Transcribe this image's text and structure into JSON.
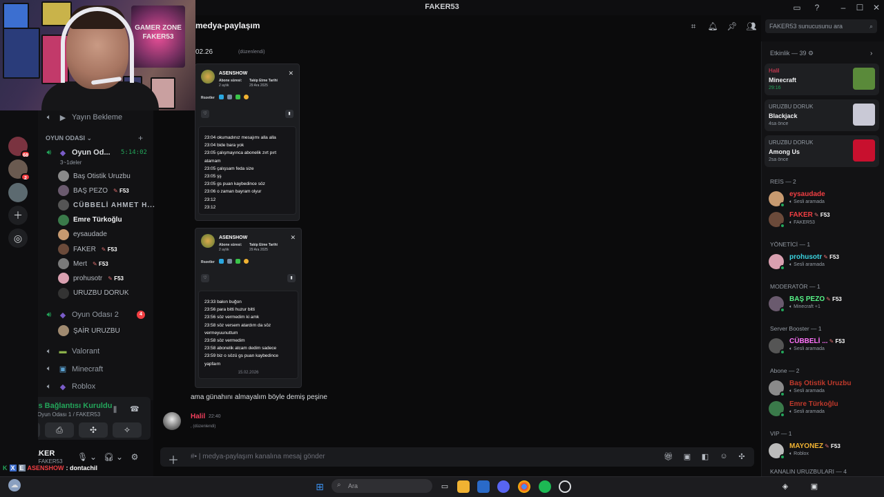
{
  "window": {
    "title": "FAKER53"
  },
  "webcam": {
    "sign_text": "GAMER ZONE FAKER53"
  },
  "rail": {
    "servers": [
      {
        "badge": "68",
        "color": "#7a3340"
      },
      {
        "badge": "2",
        "color": "#6a5a50"
      },
      {
        "badge": "",
        "color": "#5c6a70"
      }
    ]
  },
  "channels": {
    "waiting": "Yayın Bekleme",
    "category": "OYUN ODASI",
    "room1": {
      "name": "Oyun Od...",
      "timer": "5:14:02",
      "subtitle": "3~1deler"
    },
    "members": [
      {
        "name": "Baş Otistik Uruzbu",
        "tag": "",
        "color": "#8a8a8a"
      },
      {
        "name": "BAŞ PEZO",
        "tag": "F53",
        "color": "#6a5a6e"
      },
      {
        "name": "CÜBBELİ AHMET H...",
        "tag": "",
        "color": "#555"
      },
      {
        "name": "Emre Türkoğlu",
        "tag": "",
        "color": "#3a7a4a"
      },
      {
        "name": "eysaudade",
        "tag": "",
        "color": "#c79a70"
      },
      {
        "name": "FAKER",
        "tag": "F53",
        "color": "#6b4a3a"
      },
      {
        "name": "Mert",
        "tag": "F53",
        "color": "#7a7a7a"
      },
      {
        "name": "prohusotr",
        "tag": "F53",
        "color": "#d9a0b0"
      },
      {
        "name": "URUZBU DORUK",
        "tag": "",
        "color": "#333"
      }
    ],
    "room2": {
      "name": "Oyun Odası 2",
      "badge": "4"
    },
    "room2_member": "ŞAİR URUZBU",
    "others": [
      "Valorant",
      "Minecraft",
      "Roblox"
    ]
  },
  "voice": {
    "status": "Ses Bağlantısı Kuruldu",
    "sub": "Oyun Odası 1 / FAKER53"
  },
  "user": {
    "name": "FAKER",
    "status": "FAKER53"
  },
  "ticker": {
    "user": "ASENSHOW",
    "text": ": dontachil"
  },
  "header": {
    "channel": "medya-paylaşım",
    "search_placeholder": "FAKER53 sunucusunu ara"
  },
  "messages": {
    "date": "02.26",
    "edited": "(düzenlendi)",
    "card1": {
      "name": "ASENSHOW",
      "k1": "Abone süresi:",
      "v1": "2 aylık",
      "k2": "Takip Etme Tarihi",
      "v2": "29 Ara 2025",
      "rozet": "Rozetler",
      "log": [
        "23:04 okumadınız mesajımı alla alla",
        "23:04 bide bara yok",
        "23:05 çalışmayınca abonelik zırt pırt",
        "atamam",
        "23:05 çalışsam feda size",
        "23:05 şş",
        "23:05 gs puan kaybedince söz",
        "23:06 o zaman bayram olyur",
        "23:12",
        "23:12"
      ]
    },
    "card2": {
      "name": "ASENSHOW",
      "k1": "Abone süresi:",
      "v1": "2 aylık",
      "k2": "Takip Etme Tarihi",
      "v2": "29 Ara 2025",
      "rozet": "Rozetler",
      "log": [
        "23:33 bakın buğon",
        "23:56 para bitti huzur bitti",
        "23:56 söz vermedim ki amk",
        "23:58 söz versem atardım da söz",
        "vermeyuunuttum",
        "23:58 söz vermedim",
        "23:58 abonelik atcam dedim sadece",
        "23:59 biz o sözü gs puan kaybedince",
        "yapfaım"
      ],
      "log_date": "15.02.2026"
    },
    "text": "ama günahını almayalım böyle demiş peşine",
    "msg2": {
      "user": "Halil",
      "time": "22:40",
      "edited": ", (düzenlendi)"
    }
  },
  "input": {
    "placeholder": "medya-paylaşım kanalına mesaj gönder"
  },
  "members": {
    "activity_header": "Etkinlik — 39",
    "activities": [
      {
        "user": "Halil",
        "game": "Minecraft",
        "time": "29:16",
        "art": "#5a8a3a",
        "user_color": "#f23f5d",
        "time_color": "#23a55a"
      },
      {
        "user": "URUZBU DORUK",
        "game": "Blackjack",
        "time": "4sa önce",
        "art": "#c9c9d6",
        "user_color": "#949ba4",
        "time_color": "#949ba4"
      },
      {
        "user": "URUZBU DORUK",
        "game": "Among Us",
        "time": "2sa önce",
        "art": "#c8102e",
        "user_color": "#949ba4",
        "time_color": "#949ba4"
      }
    ],
    "groups": [
      {
        "title": "REİS — 2",
        "items": [
          {
            "name": "eysaudade",
            "sub": "Sesli aramada",
            "color": "#f23f43",
            "av": "#c79a70",
            "tag": ""
          },
          {
            "name": "FAKER",
            "sub": "FAKER53",
            "color": "#f23f43",
            "av": "#6b4a3a",
            "tag": "F53"
          }
        ]
      },
      {
        "title": "YÖNETİCİ — 1",
        "items": [
          {
            "name": "prohusotr",
            "sub": "Sesli aramada",
            "color": "#3ad4e0",
            "av": "#d9a0b0",
            "tag": "F53"
          }
        ]
      },
      {
        "title": "MODERATÖR — 1",
        "items": [
          {
            "name": "BAŞ PEZO",
            "sub": "Minecraft +1",
            "color": "#57f287",
            "av": "#6a5a6e",
            "tag": "F53"
          }
        ]
      },
      {
        "title": "Server Booster — 1",
        "items": [
          {
            "name": "CÜBBELİ ...",
            "sub": "Sesli aramada",
            "color": "#ff73fa",
            "av": "#555",
            "tag": "F53"
          }
        ]
      },
      {
        "title": "Abone — 2",
        "items": [
          {
            "name": "Baş Otistik Uruzbu",
            "sub": "Sesli aramada",
            "color": "#c0392b",
            "av": "#8a8a8a",
            "tag": ""
          },
          {
            "name": "Emre Türkoğlu",
            "sub": "Sesli aramada",
            "color": "#c0392b",
            "av": "#3a7a4a",
            "tag": ""
          }
        ]
      },
      {
        "title": "VIP — 1",
        "items": [
          {
            "name": "MAYONEZ",
            "sub": "Roblox",
            "color": "#f0b232",
            "av": "#bbb",
            "tag": "F53"
          }
        ]
      }
    ],
    "last_group": "KANALIN URUZBULARI — 4"
  },
  "taskbar": {
    "search": "Ara"
  }
}
